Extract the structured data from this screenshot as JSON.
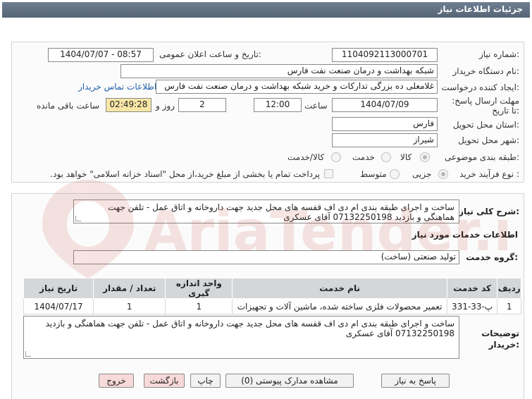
{
  "header": {
    "title": "جزئیات اطلاعات نیاز"
  },
  "form": {
    "need_number_label": "شماره نیاز:",
    "need_number": "1104092113000701",
    "announce_label": "تاریخ و ساعت اعلان عمومی:",
    "announce_value": "1404/07/07 - 08:57",
    "buyer_org_label": "نام دستگاه خریدار:",
    "buyer_org": "شبکه بهداشت و درمان صنعت نفت فارس",
    "creator_label": "ایجاد کننده درخواست:",
    "creator": "غلامعلی ده بزرگی تدارکات و خرید شبکه بهداشت و درمان صنعت نفت فارس",
    "contact_link": "اطلاعات تماس خریدار",
    "deadline_label": "مهلت ارسال پاسخ: تا تاریخ:",
    "deadline_date": "1404/07/09",
    "time_label": "ساعت",
    "deadline_time": "12:00",
    "days": "2",
    "days_label": "روز و",
    "remaining_time": "02:49:28",
    "remaining_label": "ساعت باقی مانده",
    "province_label": "استان محل تحویل:",
    "province": "فارس",
    "city_label": "شهر محل تحویل:",
    "city": "شیراز",
    "category_label": "طبقه بندی موضوعی:",
    "category_options": [
      "کالا",
      "خدمت",
      "کالا/خدمت"
    ],
    "process_label": "نوع فرآیند خرید :",
    "process_options": [
      "جزیی",
      "متوسط"
    ],
    "payment_note": "پرداخت تمام یا بخشی از مبلغ خرید،از محل \"اسناد خزانه اسلامی\" خواهد بود."
  },
  "description": {
    "label": "شرح کلی نیاز:",
    "text": "ساخت و اجرای طبقه بندی ام دی اف قفسه های محل جدید جهت داروخانه و اتاق عمل - تلفن جهت هماهنگی و بازدید 07132250198 آقای عسکری"
  },
  "services": {
    "title": "اطلاعات خدمات مورد نیاز",
    "group_label": "گروه خدمت:",
    "group_value": "تولید صنعتی (ساخت)",
    "columns": [
      "ردیف",
      "کد خدمت",
      "نام خدمت",
      "واحد اندازه گیری",
      "تعداد / مقدار",
      "تاریخ نیاز"
    ],
    "rows": [
      [
        "1",
        "پ-33-331",
        "تعمیر محصولات فلزی ساخته شده، ماشین آلات و تجهیزات",
        "1",
        "1",
        "1404/07/17"
      ]
    ]
  },
  "buyer_notes": {
    "label": "توضیحات خریدار:",
    "text": "ساخت و اجرای طبقه بندی ام دی اف قفسه های محل جدید جهت داروخانه و اتاق عمل - تلفن جهت هماهنگی و بازدید 07132250198 آقای عسکری"
  },
  "buttons": {
    "reply": "پاسخ به نیاز",
    "attachments": "مشاهده مدارک پیوستی (0)",
    "print": "چاپ",
    "back": "بازگشت",
    "exit": "خروج"
  },
  "watermark": {
    "text": "AriaTender.net"
  }
}
